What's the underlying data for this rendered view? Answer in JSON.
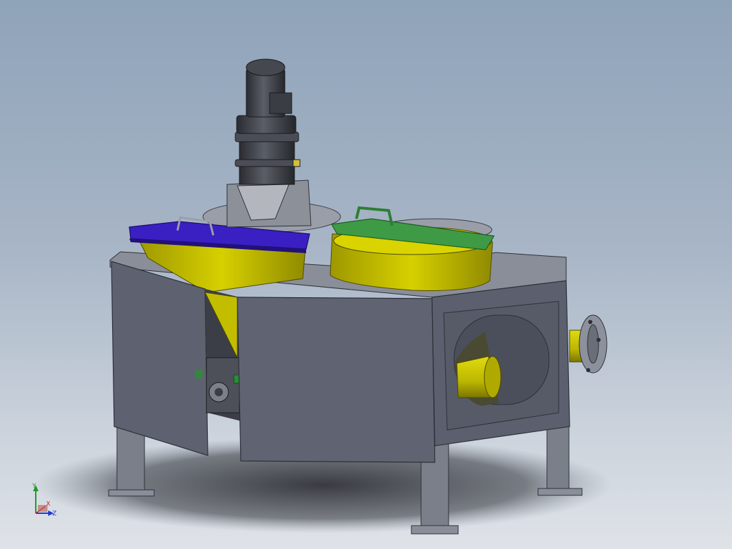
{
  "view": {
    "background_top": "#8fa3b9",
    "background_bottom": "#dfe3e8"
  },
  "colors": {
    "frame_gray": "#5e6270",
    "frame_dark": "#434753",
    "frame_light": "#8a8e99",
    "hopper_yellow": "#c8c200",
    "hopper_yellow_dark": "#8f8a00",
    "lid_blue": "#3a1fc2",
    "lid_green": "#3f9a46",
    "motor_dark": "#3c3f46",
    "gearbox_green": "#2f8a3a"
  },
  "triad": {
    "x_label": "X",
    "y_label": "Y",
    "z_label": "Z",
    "x_color": "#d32020",
    "y_color": "#1f9a2a",
    "z_color": "#2038d0"
  }
}
